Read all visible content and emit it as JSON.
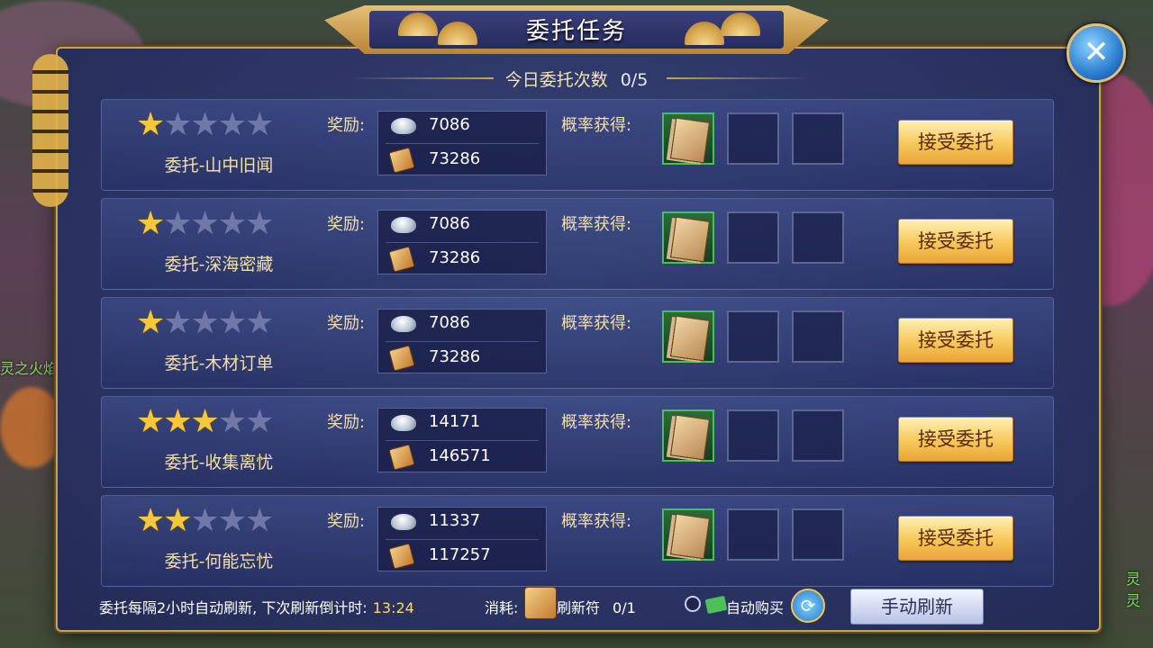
{
  "window": {
    "title": "委托任务"
  },
  "daily": {
    "label": "今日委托次数",
    "value": "0/5"
  },
  "colors": {
    "gold": "#c9a25a",
    "panel": "#2c3566",
    "accent_green": "#44c15a",
    "star": "#f5c73a"
  },
  "tasks": [
    {
      "name": "委托-山中旧闻",
      "stars": 1,
      "max_stars": 5,
      "reward_label": "奖励:",
      "silver": "7086",
      "exp": "73286",
      "prob_label": "概率获得:",
      "accept": "接受委托"
    },
    {
      "name": "委托-深海密藏",
      "stars": 1,
      "max_stars": 5,
      "reward_label": "奖励:",
      "silver": "7086",
      "exp": "73286",
      "prob_label": "概率获得:",
      "accept": "接受委托"
    },
    {
      "name": "委托-木材订单",
      "stars": 1,
      "max_stars": 5,
      "reward_label": "奖励:",
      "silver": "7086",
      "exp": "73286",
      "prob_label": "概率获得:",
      "accept": "接受委托"
    },
    {
      "name": "委托-收集离忧",
      "stars": 3,
      "max_stars": 5,
      "reward_label": "奖励:",
      "silver": "14171",
      "exp": "146571",
      "prob_label": "概率获得:",
      "accept": "接受委托"
    },
    {
      "name": "委托-何能忘忧",
      "stars": 2,
      "max_stars": 5,
      "reward_label": "奖励:",
      "silver": "11337",
      "exp": "117257",
      "prob_label": "概率获得:",
      "accept": "接受委托"
    }
  ],
  "footer": {
    "refresh_info": "委托每隔2小时自动刷新, 下次刷新倒计时:",
    "countdown": "13:24",
    "consume_label": "消耗:",
    "token_label": "刷新符",
    "token_count": "0/1",
    "auto_buy": "自动购买",
    "manual_refresh": "手动刷新"
  },
  "icons": {
    "close": "close-icon",
    "silver": "silver-ingot-icon",
    "exp": "scroll-icon",
    "cycle": "refresh-cycle-icon"
  },
  "background": {
    "left_text": "灵之火焰",
    "right_text": "灵灵"
  }
}
